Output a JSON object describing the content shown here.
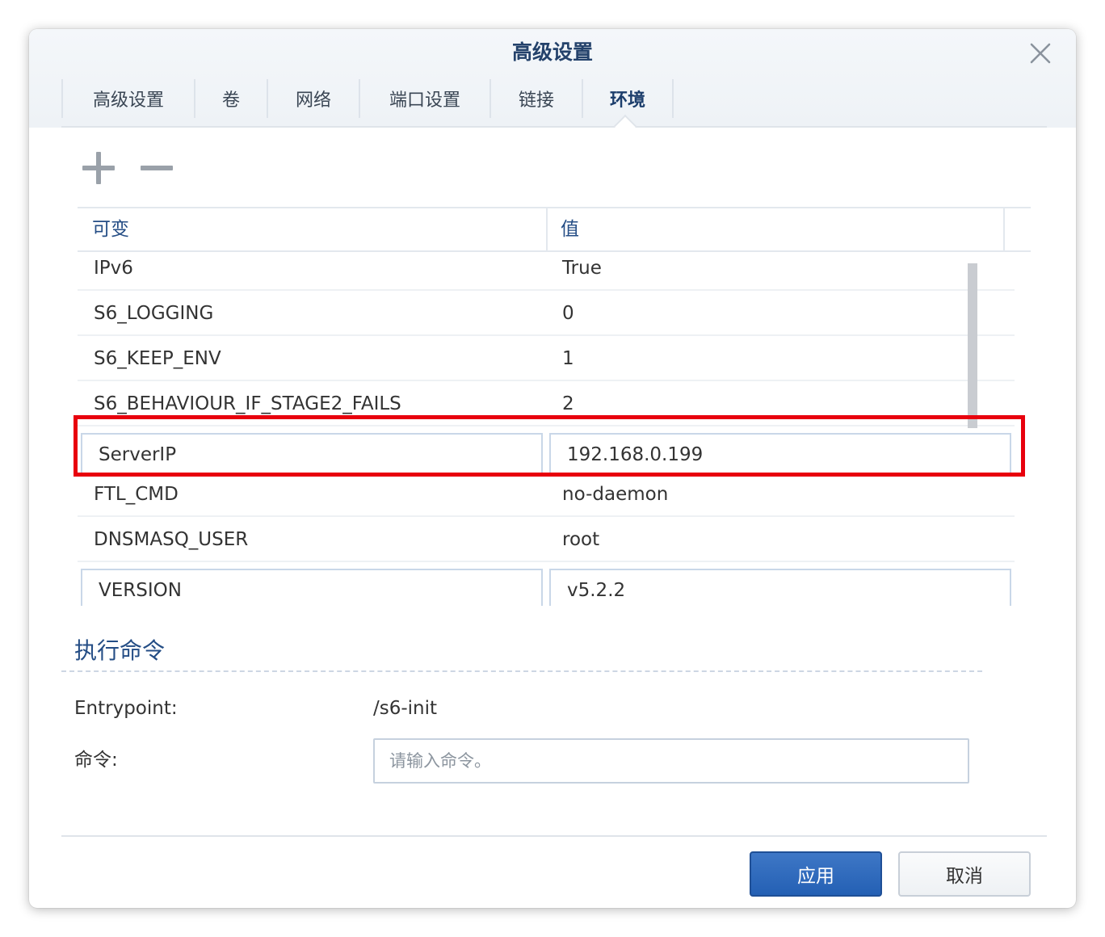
{
  "dialog": {
    "title": "高级设置"
  },
  "tabs": [
    {
      "label": "高级设置",
      "active": false
    },
    {
      "label": "卷",
      "active": false
    },
    {
      "label": "网络",
      "active": false
    },
    {
      "label": "端口设置",
      "active": false
    },
    {
      "label": "链接",
      "active": false
    },
    {
      "label": "环境",
      "active": true
    }
  ],
  "toolbar": {
    "add_icon": "plus-icon",
    "remove_icon": "minus-icon"
  },
  "env_table": {
    "columns": [
      "可变",
      "值"
    ],
    "rows": [
      {
        "name": "IPv6",
        "value": "True",
        "editing": false
      },
      {
        "name": "S6_LOGGING",
        "value": "0",
        "editing": false
      },
      {
        "name": "S6_KEEP_ENV",
        "value": "1",
        "editing": false
      },
      {
        "name": "S6_BEHAVIOUR_IF_STAGE2_FAILS",
        "value": "2",
        "editing": false
      },
      {
        "name": "ServerIP",
        "value": "192.168.0.199",
        "editing": true,
        "highlighted": true
      },
      {
        "name": "FTL_CMD",
        "value": "no-daemon",
        "editing": false
      },
      {
        "name": "DNSMASQ_USER",
        "value": "root",
        "editing": false
      },
      {
        "name": "VERSION",
        "value": "v5.2.2",
        "editing": true
      }
    ],
    "highlight_color": "#e8000d"
  },
  "exec": {
    "section_title": "执行命令",
    "entrypoint_label": "Entrypoint:",
    "entrypoint_value": "/s6-init",
    "command_label": "命令:",
    "command_placeholder": "请输入命令。",
    "command_value": ""
  },
  "footer": {
    "apply_label": "应用",
    "cancel_label": "取消",
    "apply_color": "#2a66b8"
  }
}
